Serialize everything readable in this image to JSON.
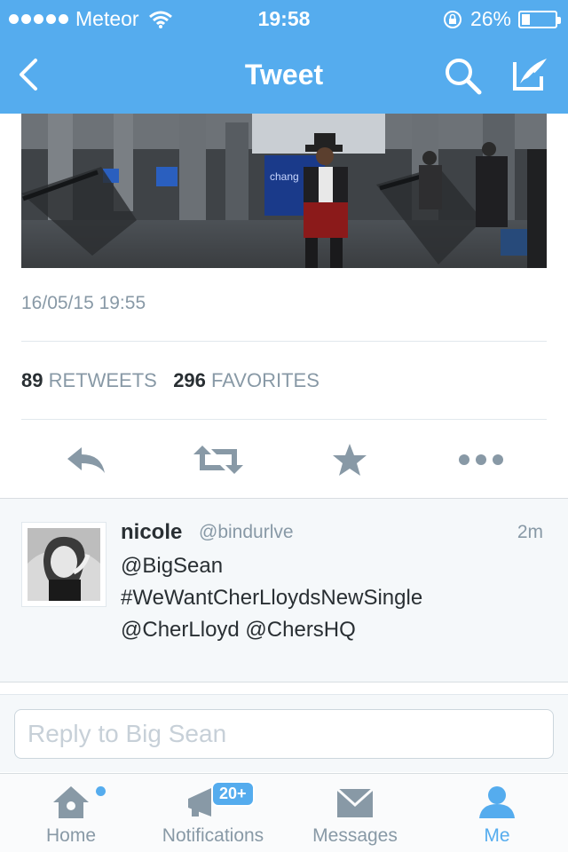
{
  "status_bar": {
    "carrier": "Meteor",
    "time": "19:58",
    "battery_percent": "26%",
    "battery_level": 0.26,
    "icons": [
      "signal-dots-icon",
      "wifi-icon",
      "rotation-lock-icon",
      "battery-icon"
    ]
  },
  "nav": {
    "title": "Tweet",
    "icons": [
      "back-chevron-icon",
      "search-icon",
      "compose-icon"
    ]
  },
  "photo": {
    "sign_text": "chang"
  },
  "tweet": {
    "timestamp": "16/05/15 19:55",
    "retweets_count": "89",
    "retweets_label": "RETWEETS",
    "favorites_count": "296",
    "favorites_label": "FAVORITES"
  },
  "actions": [
    "reply-icon",
    "retweet-icon",
    "favorite-star-icon",
    "more-icon"
  ],
  "reply": {
    "name": "nicole",
    "handle": "@bindurlve",
    "time": "2m",
    "lines": [
      "@BigSean",
      "#WeWantCherLloydsNewSingle",
      "@CherLloyd @ChersHQ"
    ]
  },
  "compose": {
    "placeholder": "Reply to Big Sean"
  },
  "tabs": {
    "home": "Home",
    "notifications": "Notifications",
    "notifications_badge": "20+",
    "messages": "Messages",
    "me": "Me"
  },
  "colors": {
    "brand": "#55acee",
    "text": "#292f33",
    "secondary": "#8899a6",
    "action_gray": "#8899a6"
  }
}
